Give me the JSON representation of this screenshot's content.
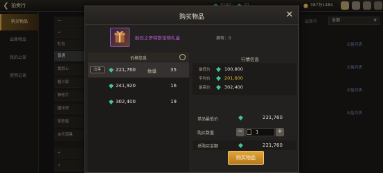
{
  "topbar": {
    "title": "拍卖行",
    "currencies": [
      {
        "value": "3142",
        "color": "#55c7d4"
      },
      {
        "value": "10",
        "color": "#4fd1a7"
      },
      {
        "value": "387万1484",
        "color": "#e6c15b"
      }
    ]
  },
  "leftnav": {
    "items": [
      {
        "label": "购买物品",
        "active": true
      },
      {
        "label": "出售物品",
        "active": false
      },
      {
        "label": "我的上架",
        "active": false
      },
      {
        "label": "使用记录",
        "active": false
      }
    ]
  },
  "catnav": {
    "items": [
      {
        "label": "一",
        "active": false
      },
      {
        "label": "+",
        "active": false
      },
      {
        "label": "礼包",
        "active": false
      },
      {
        "label": "普通",
        "active": true
      },
      {
        "label": "鬼剑士",
        "active": false
      },
      {
        "label": "格斗家",
        "active": false
      },
      {
        "label": "神枪手",
        "active": false
      },
      {
        "label": "魔法师",
        "active": false
      },
      {
        "label": "圣职者",
        "active": false
      },
      {
        "label": "本月道具",
        "active": false
      },
      {
        "label": "+",
        "active": false
      },
      {
        "label": "+",
        "active": false
      }
    ]
  },
  "background": {
    "right_tag": "出售中",
    "filter_select": "全部",
    "list_links": [
      "出售列表",
      "出售列表",
      "出售列表",
      "出售列表"
    ]
  },
  "modal": {
    "title": "购买物品",
    "item_name": "触仅之罗特斯宠物礼盒",
    "owned_label": "拥有：0",
    "price_panel": {
      "header": "价格信息",
      "sell_tag": "出售",
      "qty_label": "数量",
      "rows": [
        {
          "price": "221,760",
          "qty": "35",
          "selected": true
        },
        {
          "price": "241,920",
          "qty": "16",
          "selected": false
        },
        {
          "price": "302,400",
          "qty": "19",
          "selected": false
        }
      ]
    },
    "market": {
      "header": "行情信息",
      "rows": [
        {
          "label": "最低价",
          "value": "100,800",
          "color": "#e3dccd"
        },
        {
          "label": "平均价",
          "value": "201,600",
          "color": "#e6b63c"
        },
        {
          "label": "最高价",
          "value": "302,400",
          "color": "#e3dccd"
        }
      ]
    },
    "form": {
      "unit_price_label": "单品最低价",
      "unit_price": "221,760",
      "qty_label": "购买数量",
      "qty_value": "1",
      "total_label": "总购买金额",
      "total": "221,760"
    },
    "buy_button": "购买物品",
    "gem_color": "#3fc79a"
  }
}
